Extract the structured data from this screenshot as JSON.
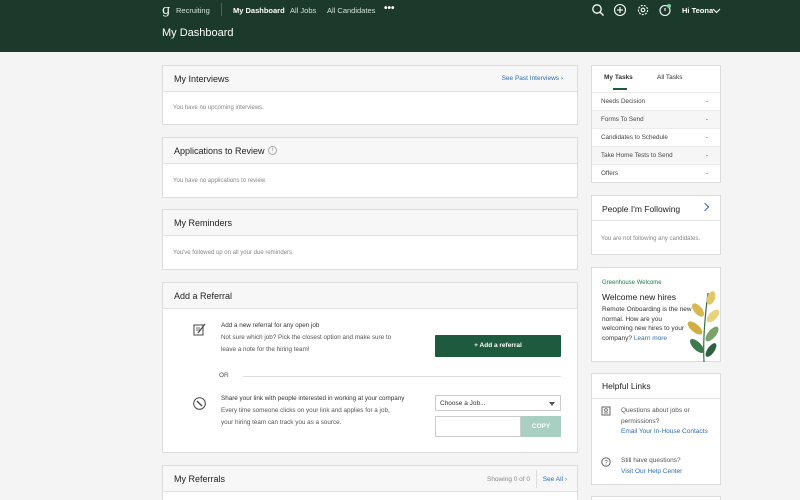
{
  "header": {
    "brand": "Recruiting",
    "nav": [
      {
        "label": "My Dashboard",
        "active": true
      },
      {
        "label": "All Jobs",
        "active": false
      },
      {
        "label": "All Candidates",
        "active": false
      },
      {
        "label": "•••",
        "active": false
      }
    ],
    "icons": [
      "search-icon",
      "add-icon",
      "settings-icon",
      "notification-icon"
    ],
    "greeting": "Hi Teona",
    "page_title": "My Dashboard"
  },
  "interviews": {
    "title": "My Interviews",
    "link": "See Past Interviews ›",
    "empty": "You have no upcoming interviews."
  },
  "applications": {
    "title": "Applications to Review",
    "empty": "You have no applications to review."
  },
  "reminders": {
    "title": "My Reminders",
    "empty": "You've followed up on all your due reminders."
  },
  "referral": {
    "title": "Add a Referral",
    "new_lead": "Add a new referral for any open job",
    "new_body_1": "Not sure which job? Pick the closest option and make sure to",
    "new_body_2": "leave a note for the hiring team!",
    "button": "+ Add a referral",
    "or": "OR",
    "share_lead": "Share your link with people interested in working at your company",
    "share_body_1": "Every time someone clicks on your link and applies for a job,",
    "share_body_2": "your hiring team can track you as a source.",
    "select_value": "Choose a Job...",
    "copy": "COPY"
  },
  "referrals": {
    "title": "My Referrals",
    "count": "Showing 0 of 0",
    "link": "See All ›"
  },
  "tasks": {
    "tabs": [
      "My Tasks",
      "All Tasks"
    ],
    "rows": [
      {
        "label": "Needs Decision",
        "value": "-"
      },
      {
        "label": "Forms To Send",
        "value": "-"
      },
      {
        "label": "Candidates to Schedule",
        "value": "-"
      },
      {
        "label": "Take Home Tests to Send",
        "value": "-"
      },
      {
        "label": "Offers",
        "value": "-"
      }
    ]
  },
  "following": {
    "title": "People I'm Following",
    "empty": "You are not following any candidates."
  },
  "welcome": {
    "kicker": "Greenhouse Welcome",
    "title": "Welcome new hires",
    "body": "Remote Onboarding is the new normal. How are you welcoming new hires to your company?",
    "link": "Learn more"
  },
  "help": {
    "title": "Helpful Links",
    "q1": "Questions about jobs or permissions?",
    "q1_link": "Email Your In-House Contacts",
    "q2": "Still have questions?",
    "q2_link": "Visit Our Help Center"
  },
  "colors": {
    "header_bg": "#1b3a2c",
    "accent": "#1d5a3e",
    "link": "#2f6fb0"
  }
}
